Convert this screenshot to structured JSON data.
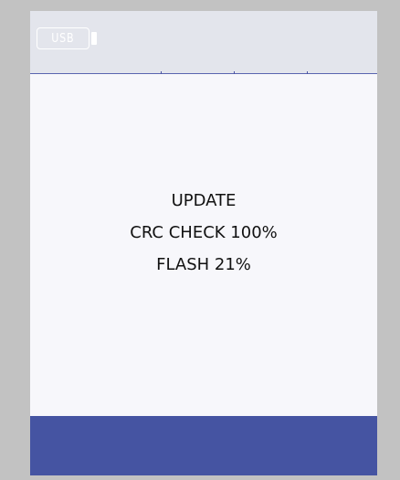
{
  "status_bar": {
    "usb_indicator": {
      "icon": "usb-stick-icon",
      "label": "USB"
    }
  },
  "message": {
    "line1": "UPDATE",
    "line2": "CRC CHECK 100%",
    "line3": "FLASH 21%"
  },
  "progress": {
    "crc_check_percent": 100,
    "flash_percent": 21
  },
  "colors": {
    "outer_frame": "#c2c2c2",
    "screen_background": "#f7f7fb",
    "status_bar": "#e3e5ec",
    "status_bar_border": "#5a64b0",
    "bottom_bar": "#4554a2",
    "text": "#111111"
  }
}
